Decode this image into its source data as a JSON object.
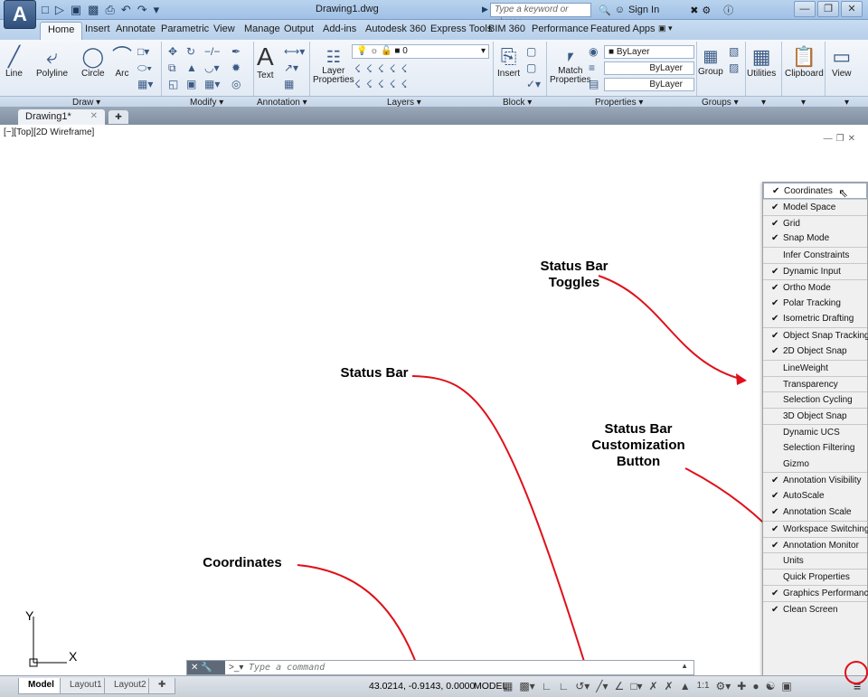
{
  "title": {
    "document": "Drawing1.dwg",
    "search_placeholder": "Type a keyword or phrase",
    "sign_in": "Sign In"
  },
  "ribbon_tabs": [
    {
      "label": "Home",
      "active": true
    },
    {
      "label": "Insert"
    },
    {
      "label": "Annotate"
    },
    {
      "label": "Parametric"
    },
    {
      "label": "View"
    },
    {
      "label": "Manage"
    },
    {
      "label": "Output"
    },
    {
      "label": "Add-ins"
    },
    {
      "label": "Autodesk 360"
    },
    {
      "label": "Express Tools"
    },
    {
      "label": "BIM 360"
    },
    {
      "label": "Performance"
    },
    {
      "label": "Featured Apps"
    }
  ],
  "ribbon": {
    "draw": {
      "line": "Line",
      "polyline": "Polyline",
      "circle": "Circle",
      "arc": "Arc",
      "panel": "Draw ▾"
    },
    "modify": {
      "panel": "Modify ▾"
    },
    "annotation": {
      "text": "Text",
      "panel": "Annotation ▾"
    },
    "layers": {
      "layer_properties": "Layer\nProperties",
      "current_layer": "0",
      "panel": "Layers ▾"
    },
    "block": {
      "insert": "Insert",
      "panel": "Block ▾"
    },
    "properties": {
      "match": "Match\nProperties",
      "color": "ByLayer",
      "linetype": "ByLayer",
      "lineweight": "ByLayer",
      "panel": "Properties ▾"
    },
    "groups": {
      "group": "Group",
      "panel": "Groups ▾"
    },
    "utilities": "Utilities",
    "clipboard": "Clipboard",
    "view": "View"
  },
  "file_tab": {
    "name": "Drawing1*"
  },
  "viewport_label": "[−][Top][2D Wireframe]",
  "annotations": {
    "toggles": "Status Bar\nToggles",
    "status_bar": "Status Bar",
    "customization": "Status Bar\nCustomization\nButton",
    "coordinates": "Coordinates"
  },
  "menu_items": [
    {
      "label": "Coordinates",
      "checked": true,
      "hover": true
    },
    {
      "label": "Model Space",
      "checked": true,
      "sep": true
    },
    {
      "label": "Grid",
      "checked": true,
      "sep": true
    },
    {
      "label": "Snap Mode",
      "checked": true
    },
    {
      "label": "Infer Constraints",
      "checked": false,
      "sep": true
    },
    {
      "label": "Dynamic Input",
      "checked": true,
      "sep": true
    },
    {
      "label": "Ortho Mode",
      "checked": true,
      "sep": true
    },
    {
      "label": "Polar Tracking",
      "checked": true
    },
    {
      "label": "Isometric Drafting",
      "checked": true
    },
    {
      "label": "Object Snap Tracking",
      "checked": true,
      "sep": true
    },
    {
      "label": "2D Object Snap",
      "checked": true
    },
    {
      "label": "LineWeight",
      "checked": false,
      "sep": true
    },
    {
      "label": "Transparency",
      "checked": false,
      "sep": true
    },
    {
      "label": "Selection Cycling",
      "checked": false,
      "sep": true
    },
    {
      "label": "3D Object Snap",
      "checked": false,
      "sep": true
    },
    {
      "label": "Dynamic UCS",
      "checked": false,
      "sep": true
    },
    {
      "label": "Selection Filtering",
      "checked": false
    },
    {
      "label": "Gizmo",
      "checked": false
    },
    {
      "label": "Annotation Visibility",
      "checked": true,
      "sep": true
    },
    {
      "label": "AutoScale",
      "checked": true
    },
    {
      "label": "Annotation Scale",
      "checked": true
    },
    {
      "label": "Workspace Switching",
      "checked": true,
      "sep": true
    },
    {
      "label": "Annotation Monitor",
      "checked": true,
      "sep": true
    },
    {
      "label": "Units",
      "checked": false,
      "sep": true
    },
    {
      "label": "Quick Properties",
      "checked": false,
      "sep": true
    },
    {
      "label": "Graphics Performance",
      "checked": true,
      "sep": true
    },
    {
      "label": "Clean Screen",
      "checked": true,
      "sep": true
    }
  ],
  "command_line": {
    "placeholder": "Type a command"
  },
  "status_bar": {
    "layouts": [
      "Model",
      "Layout1",
      "Layout2"
    ],
    "coordinates": "43.0214, -0.9143, 0.0000",
    "model": "MODEL",
    "scale": "1:1"
  },
  "ucs": {
    "x_label": "X",
    "y_label": "Y"
  },
  "colors": {
    "annotation_arrow": "#e0101a",
    "menu_bg": "#f0f0f0"
  }
}
